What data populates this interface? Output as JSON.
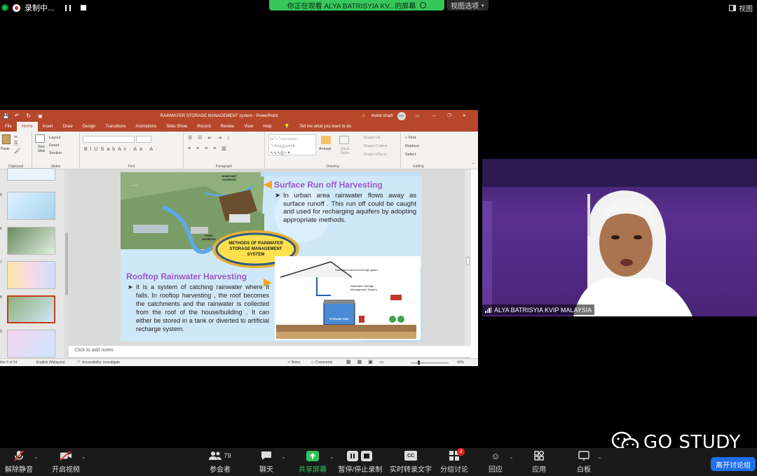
{
  "topbar": {
    "recording_label": "录制中...",
    "share_banner": "你正在观看 ALYA BATRISYIA KV...的屏幕",
    "view_options": "视图选项",
    "view": "视图"
  },
  "powerpoint": {
    "window_title": "RAINWATER STORAGE MANAGEMENT system  -  PowerPoint",
    "user_name": "mohd sharil",
    "user_initials": "MS",
    "tabs": [
      "File",
      "Home",
      "Insert",
      "Draw",
      "Design",
      "Transitions",
      "Animations",
      "Slide Show",
      "Record",
      "Review",
      "View",
      "Help"
    ],
    "tell_me": "Tell me what you want to do",
    "ribbon_groups": {
      "clipboard": "Clipboard",
      "slides": "Slides",
      "font": "Font",
      "paragraph": "Paragraph",
      "drawing": "Drawing",
      "editing": "Editing"
    },
    "ribbon_items": {
      "paste": "Paste",
      "new_slide": "New Slide",
      "layout": "Layout",
      "reset": "Reset",
      "section": "Section",
      "arrange": "Arrange",
      "quick_styles": "Quick Styles",
      "shape_fill": "Shape Fill",
      "shape_outline": "Shape Outline",
      "shape_effects": "Shape Effects",
      "find": "Find",
      "replace": "Replace",
      "select": "Select"
    },
    "thumb_numbers": [
      "5",
      "6",
      "7",
      "8",
      "9",
      "10"
    ],
    "slide": {
      "title1": "Surface Run off Harvesting",
      "body1": "In urban area rainwater flows away as surface runoff . This run off could be caught and used for recharging aquifers by adopting appropriate methods.",
      "center_label": "METHODS OF RAINWATER STORAGE MANAGEMENT SYSTEM",
      "title2": "Rooftop Rainwater Harvesting",
      "body2": "It is a system of catching rainwater  where it falls. In rooftop harvesting , the  roof becomes the catchments and the  rainwater is collected from the roof of  the house/building . It can either be  stored in a tank or diverted to artificial  recharge system.",
      "diagram_label1": "Rainwater collected through gutter",
      "diagram_label2": "Rainwater Storage Management System",
      "diagram_tank": "STORAGE TANK",
      "map_label1": "NONPOINT SOURCES",
      "map_label2": "POINT SOURCES"
    },
    "notes_placeholder": "Click to add notes",
    "status": {
      "slide": "lide 9 of 14",
      "language": "English (Malaysia)",
      "accessibility": "Accessibility: Investigate",
      "notes": "Notes",
      "comments": "Comments",
      "zoom": "42%"
    }
  },
  "video": {
    "participant_name": "ALYA BATRISYIA KVIP MALAYSIA"
  },
  "watermark": "GO STUDY",
  "toolbar": {
    "unmute": "解除静音",
    "start_video": "开启视频",
    "participants": "参会者",
    "participants_count": "79",
    "chat": "聊天",
    "share": "共享屏幕",
    "pause_record": "暂停/停止录制",
    "caption": "实时转录文字",
    "caption_icon": "CC",
    "breakout": "分组讨论",
    "breakout_badge": "3",
    "reactions": "回应",
    "apps": "应用",
    "whiteboard": "白板",
    "leave": "离开讨论组"
  }
}
